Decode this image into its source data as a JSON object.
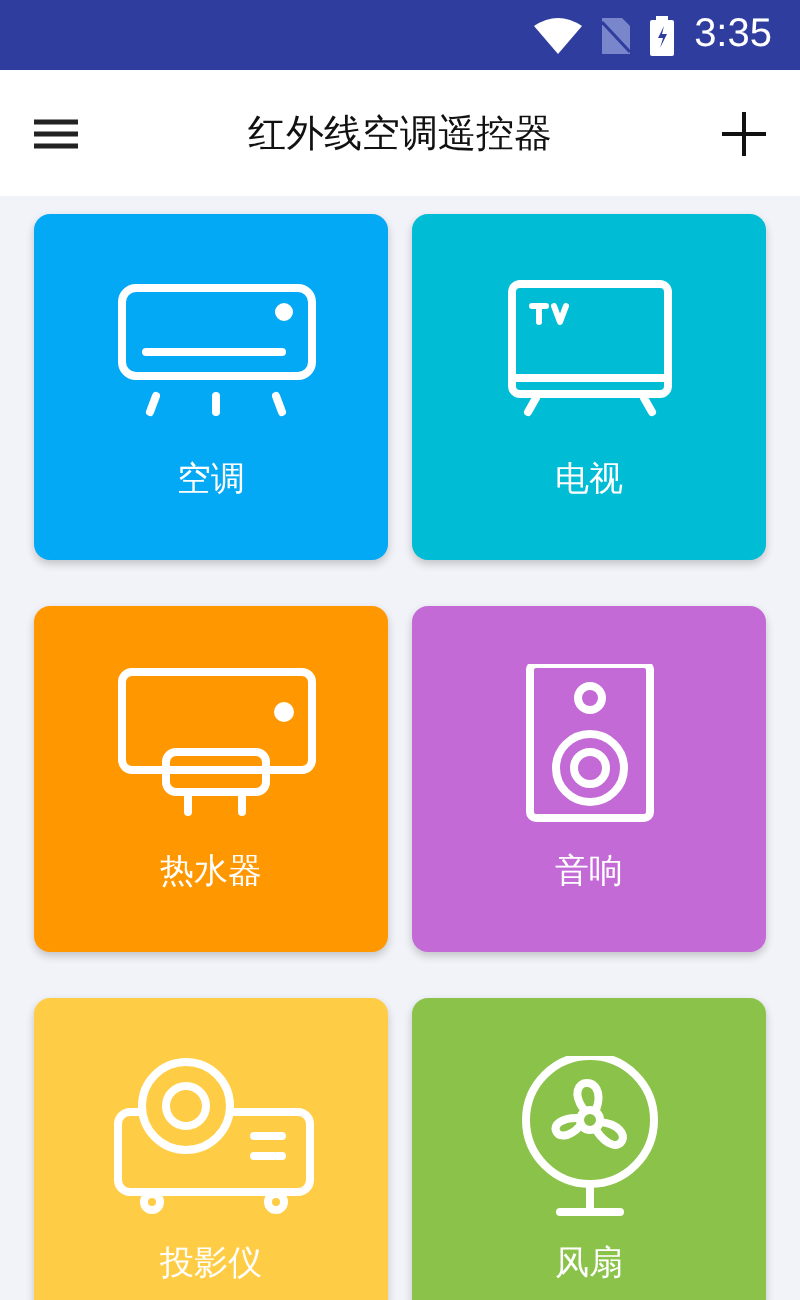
{
  "status_bar": {
    "time": "3:35"
  },
  "toolbar": {
    "title": "红外线空调遥控器"
  },
  "devices": [
    {
      "label": "空调",
      "kind": "ac",
      "color": "#03a9f4"
    },
    {
      "label": "电视",
      "kind": "tv",
      "color": "#00bcd4"
    },
    {
      "label": "热水器",
      "kind": "heater",
      "color": "#ff9800"
    },
    {
      "label": "音响",
      "kind": "speaker",
      "color": "#c36ad6"
    },
    {
      "label": "投影仪",
      "kind": "projector",
      "color": "#ffcd45"
    },
    {
      "label": "风扇",
      "kind": "fan",
      "color": "#8bc34a"
    }
  ]
}
